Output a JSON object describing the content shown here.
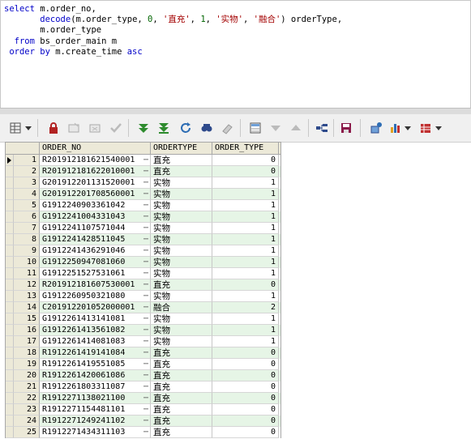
{
  "editor": {
    "lines": [
      [
        {
          "t": "select ",
          "c": "kw"
        },
        {
          "t": "m",
          "c": "ident"
        },
        {
          "t": ".",
          "c": "ident"
        },
        {
          "t": "order_no",
          "c": "ident"
        },
        {
          "t": ",",
          "c": "ident"
        }
      ],
      [
        {
          "t": "       decode",
          "c": "kw"
        },
        {
          "t": "(",
          "c": "ident"
        },
        {
          "t": "m",
          "c": "ident"
        },
        {
          "t": ".",
          "c": "ident"
        },
        {
          "t": "order_type, ",
          "c": "ident"
        },
        {
          "t": "0",
          "c": "num"
        },
        {
          "t": ", ",
          "c": "ident"
        },
        {
          "t": "'直充'",
          "c": "str"
        },
        {
          "t": ", ",
          "c": "ident"
        },
        {
          "t": "1",
          "c": "num"
        },
        {
          "t": ", ",
          "c": "ident"
        },
        {
          "t": "'实物'",
          "c": "str"
        },
        {
          "t": ", ",
          "c": "ident"
        },
        {
          "t": "'融合'",
          "c": "str"
        },
        {
          "t": ") orderType,",
          "c": "ident"
        }
      ],
      [
        {
          "t": "       m",
          "c": "ident"
        },
        {
          "t": ".",
          "c": "ident"
        },
        {
          "t": "order_type",
          "c": "ident"
        }
      ],
      [
        {
          "t": "  from ",
          "c": "kw"
        },
        {
          "t": "bs_order_main m",
          "c": "ident"
        }
      ],
      [
        {
          "t": " order by ",
          "c": "kw"
        },
        {
          "t": "m",
          "c": "ident"
        },
        {
          "t": ".",
          "c": "ident"
        },
        {
          "t": "create_time ",
          "c": "ident"
        },
        {
          "t": "asc",
          "c": "kw"
        }
      ]
    ]
  },
  "toolbar": {
    "icons": [
      "grid-options-icon",
      "dropdown-arrow-icon",
      "lock-icon",
      "new-record-icon",
      "delete-record-icon",
      "post-check-icon",
      "fetch-next-icon",
      "fetch-last-icon",
      "refresh-icon",
      "find-icon",
      "clear-icon",
      "query-by-example-icon",
      "sort-descending-icon",
      "sort-ascending-icon",
      "single-record-view-icon",
      "save-icon",
      "connect-icon",
      "chart-icon",
      "chart-dropdown-icon",
      "export-icon",
      "export-dropdown-icon"
    ]
  },
  "grid": {
    "columns": [
      "ORDER_NO",
      "ORDERTYPE",
      "ORDER_TYPE"
    ],
    "rows": [
      {
        "n": "1",
        "order_no": "R201912181621540001",
        "ordertype": "直充",
        "order_type": "0"
      },
      {
        "n": "2",
        "order_no": "R201912181622010001",
        "ordertype": "直充",
        "order_type": "0"
      },
      {
        "n": "3",
        "order_no": "G201912201131520001",
        "ordertype": "实物",
        "order_type": "1"
      },
      {
        "n": "4",
        "order_no": "G201912201708560001",
        "ordertype": "实物",
        "order_type": "1"
      },
      {
        "n": "5",
        "order_no": "G1912240903361042",
        "ordertype": "实物",
        "order_type": "1"
      },
      {
        "n": "6",
        "order_no": "G1912241004331043",
        "ordertype": "实物",
        "order_type": "1"
      },
      {
        "n": "7",
        "order_no": "G1912241107571044",
        "ordertype": "实物",
        "order_type": "1"
      },
      {
        "n": "8",
        "order_no": "G1912241428511045",
        "ordertype": "实物",
        "order_type": "1"
      },
      {
        "n": "9",
        "order_no": "G1912241436291046",
        "ordertype": "实物",
        "order_type": "1"
      },
      {
        "n": "10",
        "order_no": "G1912250947081060",
        "ordertype": "实物",
        "order_type": "1"
      },
      {
        "n": "11",
        "order_no": "G1912251527531061",
        "ordertype": "实物",
        "order_type": "1"
      },
      {
        "n": "12",
        "order_no": "R201912181607530001",
        "ordertype": "直充",
        "order_type": "0"
      },
      {
        "n": "13",
        "order_no": "G1912260950321080",
        "ordertype": "实物",
        "order_type": "1"
      },
      {
        "n": "14",
        "order_no": "C201912201052000001",
        "ordertype": "融合",
        "order_type": "2"
      },
      {
        "n": "15",
        "order_no": "G1912261413141081",
        "ordertype": "实物",
        "order_type": "1"
      },
      {
        "n": "16",
        "order_no": "G1912261413561082",
        "ordertype": "实物",
        "order_type": "1"
      },
      {
        "n": "17",
        "order_no": "G1912261414081083",
        "ordertype": "实物",
        "order_type": "1"
      },
      {
        "n": "18",
        "order_no": "R1912261419141084",
        "ordertype": "直充",
        "order_type": "0"
      },
      {
        "n": "19",
        "order_no": "R1912261419551085",
        "ordertype": "直充",
        "order_type": "0"
      },
      {
        "n": "20",
        "order_no": "R1912261420061086",
        "ordertype": "直充",
        "order_type": "0"
      },
      {
        "n": "21",
        "order_no": "R1912261803311087",
        "ordertype": "直充",
        "order_type": "0"
      },
      {
        "n": "22",
        "order_no": "R1912271138021100",
        "ordertype": "直充",
        "order_type": "0"
      },
      {
        "n": "23",
        "order_no": "R1912271154481101",
        "ordertype": "直充",
        "order_type": "0"
      },
      {
        "n": "24",
        "order_no": "R1912271249241102",
        "ordertype": "直充",
        "order_type": "0"
      },
      {
        "n": "25",
        "order_no": "R1912271434311103",
        "ordertype": "直充",
        "order_type": "0"
      }
    ]
  }
}
